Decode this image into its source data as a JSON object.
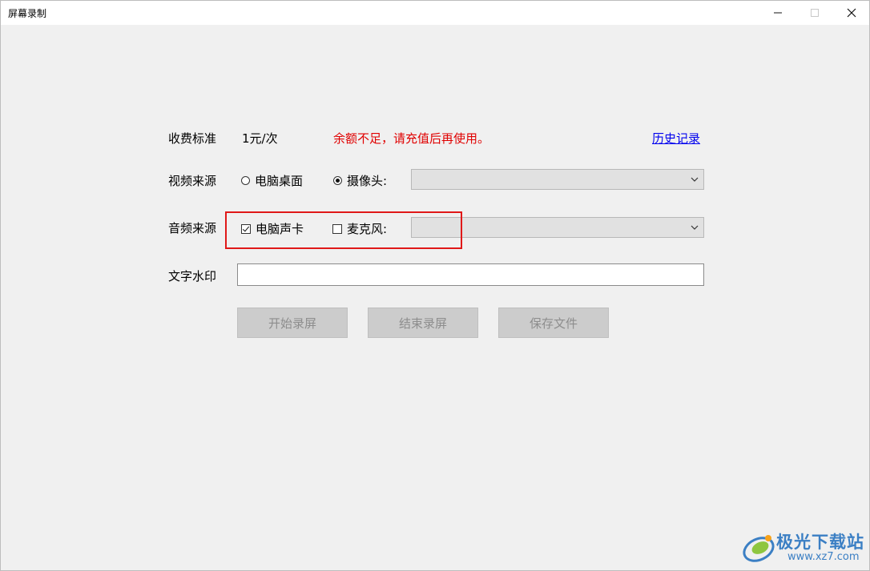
{
  "window": {
    "title": "屏幕录制"
  },
  "fee": {
    "label": "收费标准",
    "value": "1元/次",
    "warning": "余额不足，请充值后再使用。",
    "history_link": "历史记录"
  },
  "video_source": {
    "label": "视频来源",
    "options": [
      {
        "label": "电脑桌面",
        "selected": false
      },
      {
        "label": "摄像头:",
        "selected": true
      }
    ],
    "device_select_value": ""
  },
  "audio_source": {
    "label": "音频来源",
    "options": [
      {
        "label": "电脑声卡",
        "checked": true
      },
      {
        "label": "麦克风:",
        "checked": false
      }
    ],
    "device_select_value": ""
  },
  "text_watermark": {
    "label": "文字水印",
    "value": ""
  },
  "actions": {
    "start_label": "开始录屏",
    "stop_label": "结束录屏",
    "save_label": "保存文件"
  },
  "site_watermark": {
    "name": "极光下载站",
    "url": "www.xz7.com"
  },
  "colors": {
    "warning": "#e00000",
    "link": "#0000ee",
    "highlight": "#e01818",
    "watermark": "#3b7fc4"
  }
}
